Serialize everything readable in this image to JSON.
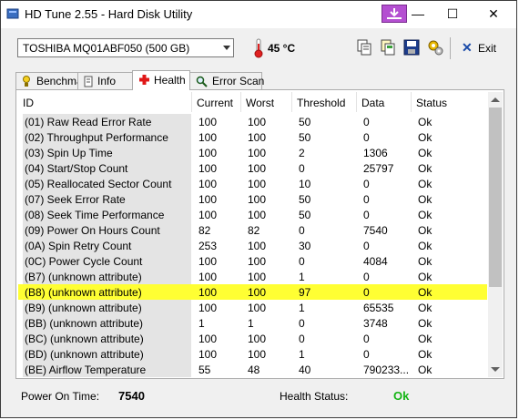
{
  "window": {
    "title": "HD Tune 2.55 - Hard Disk Utility",
    "minimize": "—",
    "maximize": "☐",
    "close": "✕"
  },
  "toolbar": {
    "drive": "TOSHIBA MQ01ABF050 (500 GB)",
    "temperature": "45 °C",
    "exit_label": "Exit",
    "icons": [
      "copy-icon",
      "copy-all-icon",
      "save-icon",
      "options-icon",
      "exit-icon"
    ]
  },
  "tabs": [
    {
      "label": "Benchmark",
      "icon": "benchmark-icon",
      "active": false
    },
    {
      "label": "Info",
      "icon": "info-icon",
      "active": false
    },
    {
      "label": "Health",
      "icon": "health-icon",
      "active": true
    },
    {
      "label": "Error Scan",
      "icon": "error-scan-icon",
      "active": false
    }
  ],
  "table": {
    "columns": [
      "ID",
      "Current",
      "Worst",
      "Threshold",
      "Data",
      "Status"
    ],
    "rows": [
      {
        "id": "(01) Raw Read Error Rate",
        "current": "100",
        "worst": "100",
        "threshold": "50",
        "data": "0",
        "status": "Ok"
      },
      {
        "id": "(02) Throughput Performance",
        "current": "100",
        "worst": "100",
        "threshold": "50",
        "data": "0",
        "status": "Ok"
      },
      {
        "id": "(03) Spin Up Time",
        "current": "100",
        "worst": "100",
        "threshold": "2",
        "data": "1306",
        "status": "Ok"
      },
      {
        "id": "(04) Start/Stop Count",
        "current": "100",
        "worst": "100",
        "threshold": "0",
        "data": "25797",
        "status": "Ok"
      },
      {
        "id": "(05) Reallocated Sector Count",
        "current": "100",
        "worst": "100",
        "threshold": "10",
        "data": "0",
        "status": "Ok"
      },
      {
        "id": "(07) Seek Error Rate",
        "current": "100",
        "worst": "100",
        "threshold": "50",
        "data": "0",
        "status": "Ok"
      },
      {
        "id": "(08) Seek Time Performance",
        "current": "100",
        "worst": "100",
        "threshold": "50",
        "data": "0",
        "status": "Ok"
      },
      {
        "id": "(09) Power On Hours Count",
        "current": "82",
        "worst": "82",
        "threshold": "0",
        "data": "7540",
        "status": "Ok"
      },
      {
        "id": "(0A) Spin Retry Count",
        "current": "253",
        "worst": "100",
        "threshold": "30",
        "data": "0",
        "status": "Ok"
      },
      {
        "id": "(0C) Power Cycle Count",
        "current": "100",
        "worst": "100",
        "threshold": "0",
        "data": "4084",
        "status": "Ok"
      },
      {
        "id": "(B7) (unknown attribute)",
        "current": "100",
        "worst": "100",
        "threshold": "1",
        "data": "0",
        "status": "Ok"
      },
      {
        "id": "(B8) (unknown attribute)",
        "current": "100",
        "worst": "100",
        "threshold": "97",
        "data": "0",
        "status": "Ok",
        "highlight": true
      },
      {
        "id": "(B9) (unknown attribute)",
        "current": "100",
        "worst": "100",
        "threshold": "1",
        "data": "65535",
        "status": "Ok"
      },
      {
        "id": "(BB) (unknown attribute)",
        "current": "1",
        "worst": "1",
        "threshold": "0",
        "data": "3748",
        "status": "Ok"
      },
      {
        "id": "(BC) (unknown attribute)",
        "current": "100",
        "worst": "100",
        "threshold": "0",
        "data": "0",
        "status": "Ok"
      },
      {
        "id": "(BD) (unknown attribute)",
        "current": "100",
        "worst": "100",
        "threshold": "1",
        "data": "0",
        "status": "Ok"
      },
      {
        "id": "(BE) Airflow Temperature",
        "current": "55",
        "worst": "48",
        "threshold": "40",
        "data": "790233...",
        "status": "Ok"
      }
    ]
  },
  "status": {
    "power_on_label": "Power On Time:",
    "power_on_value": "7540",
    "health_label": "Health Status:",
    "health_value": "Ok"
  },
  "colors": {
    "highlight": "#ffff33",
    "health_ok": "#14b414",
    "capture_button": "#b44fd1"
  }
}
